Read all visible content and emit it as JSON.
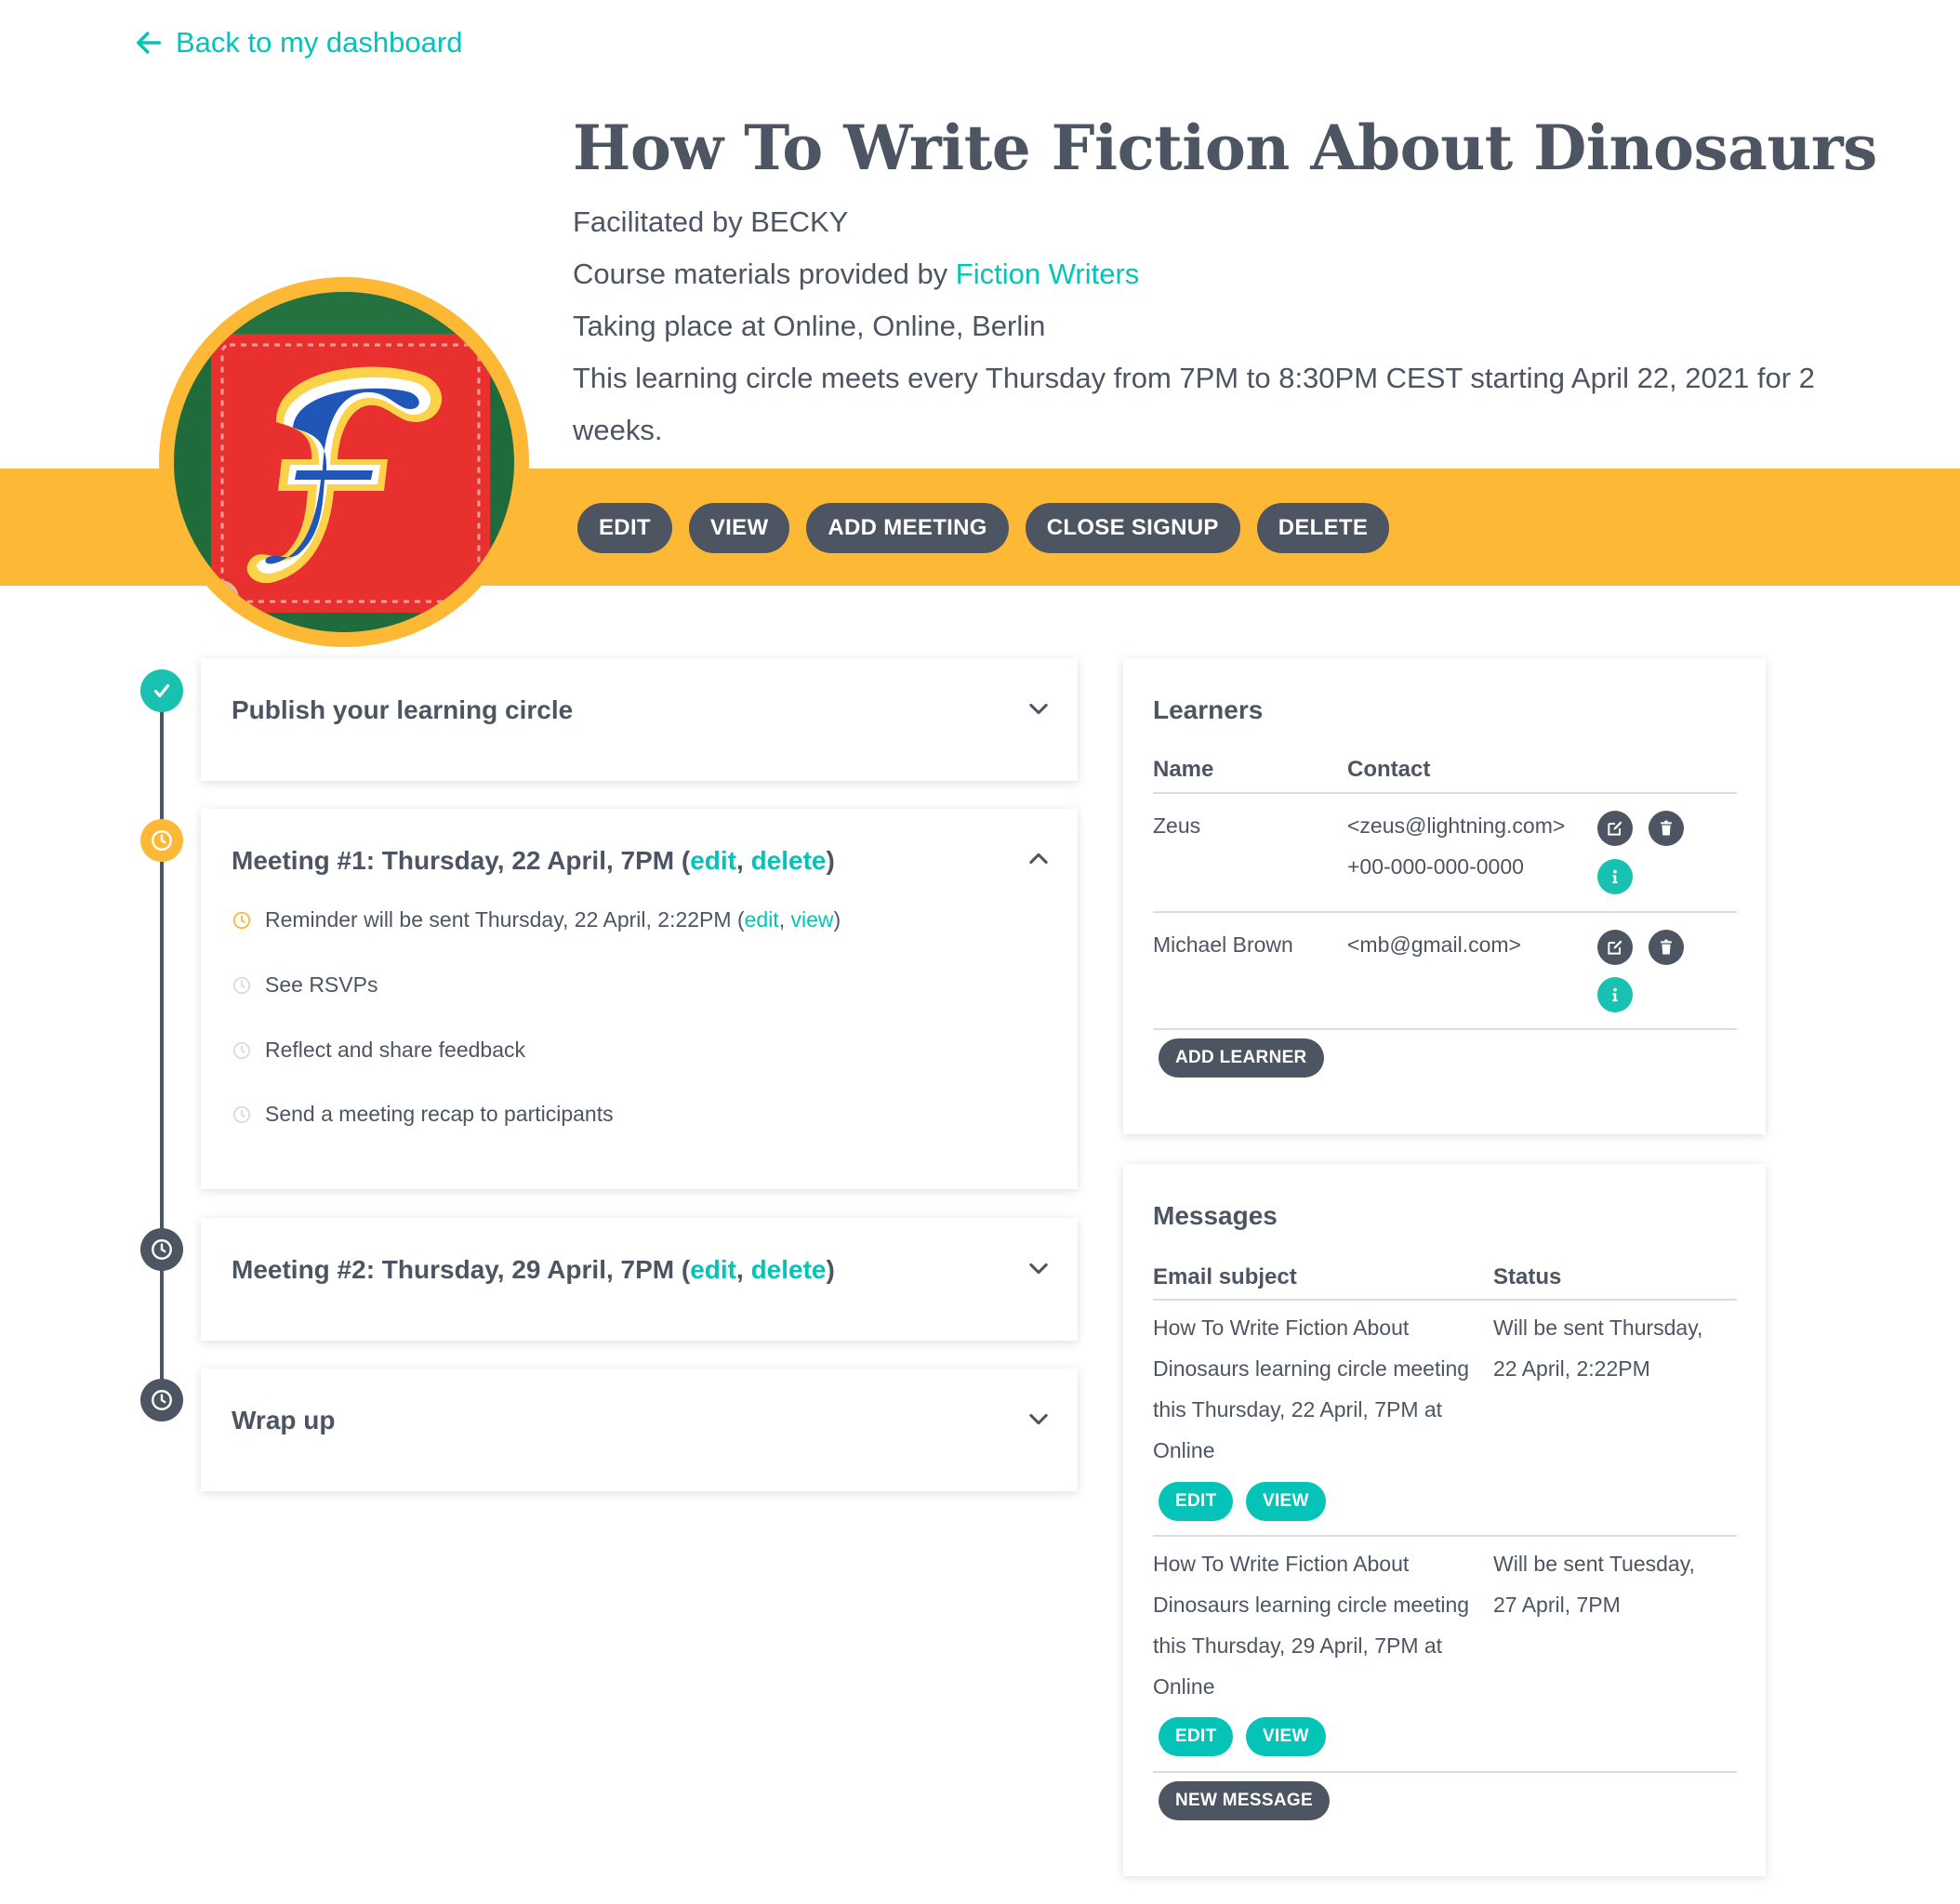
{
  "nav": {
    "back_label": "Back to my dashboard"
  },
  "course": {
    "title": "How To Write Fiction About Dinosaurs",
    "facilitated": "Facilitated by BECKY",
    "materials_prefix": "Course materials provided by ",
    "materials_link": "Fiction Writers",
    "location": "Taking place at Online, Online, Berlin",
    "schedule_line1": "This learning circle meets every Thursday from 7PM to 8:30PM CEST starting April 22, 2021 for 2",
    "schedule_line2": "weeks."
  },
  "actions": {
    "edit": "EDIT",
    "view": "VIEW",
    "add_meeting": "ADD MEETING",
    "close_signup": "CLOSE SIGNUP",
    "delete": "DELETE"
  },
  "timeline": {
    "publish": {
      "title": "Publish your learning circle"
    },
    "meeting1": {
      "title": "Meeting #1: Thursday, 22 April, 7PM (",
      "edit": "edit",
      "sep": ", ",
      "delete": "delete",
      "close": ")",
      "tasks": {
        "reminder": "Reminder will be sent Thursday, 22 April, 2:22PM (",
        "reminder_edit": "edit",
        "reminder_sep": ", ",
        "reminder_view": "view",
        "reminder_close": ")",
        "rsvps": "See RSVPs",
        "reflect": "Reflect and share feedback",
        "recap": "Send a meeting recap to participants"
      }
    },
    "meeting2": {
      "title": "Meeting #2: Thursday, 29 April, 7PM (",
      "edit": "edit",
      "sep": ", ",
      "delete": "delete",
      "close": ")"
    },
    "wrapup": {
      "title": "Wrap up"
    }
  },
  "learners": {
    "heading": "Learners",
    "col_name": "Name",
    "col_contact": "Contact",
    "rows": [
      {
        "name": "Zeus",
        "email": "<zeus@lightning.com>",
        "phone": "+00-000-000-0000"
      },
      {
        "name": "Michael Brown",
        "email": "<mb@gmail.com>",
        "phone": ""
      }
    ],
    "add_label": "ADD LEARNER"
  },
  "messages": {
    "heading": "Messages",
    "col_subject": "Email subject",
    "col_status": "Status",
    "rows": [
      {
        "subject_lines": [
          "How To Write Fiction About",
          "Dinosaurs learning circle meeting",
          "this Thursday, 22 April, 7PM at",
          "Online"
        ],
        "status_lines": [
          "Will be sent Thursday,",
          "22 April, 2:22PM"
        ],
        "edit": "EDIT",
        "view": "VIEW"
      },
      {
        "subject_lines": [
          "How To Write Fiction About",
          "Dinosaurs learning circle meeting",
          "this Thursday, 29 April, 7PM at",
          "Online"
        ],
        "status_lines": [
          "Will be sent Tuesday,",
          "27 April, 7PM"
        ],
        "edit": "EDIT",
        "view": "VIEW"
      }
    ],
    "new_label": "NEW MESSAGE"
  },
  "colors": {
    "accent": "#05c3b6",
    "band": "#fdb836",
    "dark": "#4d5562",
    "pending": "#fdb836"
  }
}
